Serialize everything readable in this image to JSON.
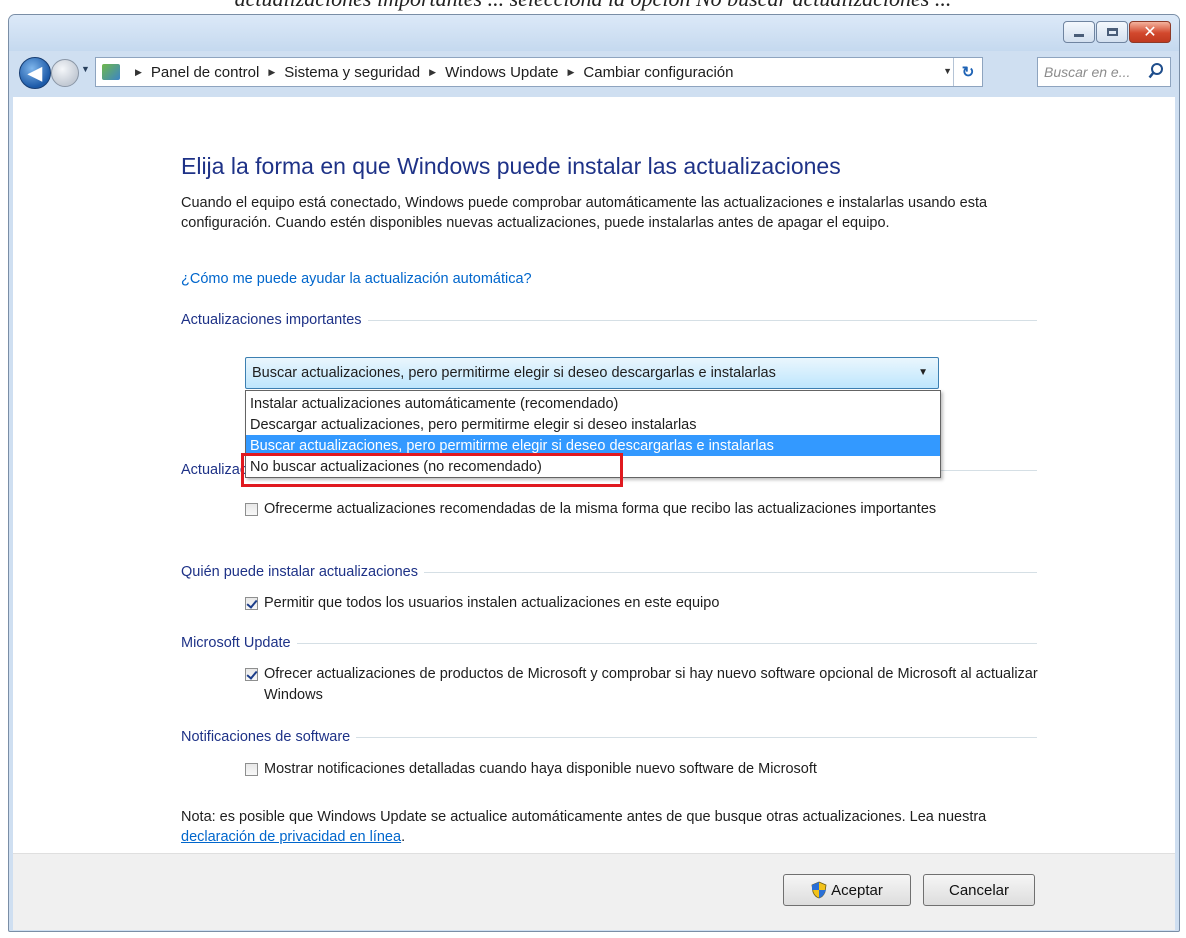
{
  "top_caption": "actualizaciones importantes ... selecciona la opción No buscar actualizaciones ...",
  "window": {
    "caption_buttons": {
      "minimize_icon": "minimize-icon",
      "maximize_icon": "maximize-icon",
      "close_icon": "close-icon"
    }
  },
  "navbar": {
    "breadcrumb": [
      "Panel de control",
      "Sistema y seguridad",
      "Windows Update",
      "Cambiar configuración"
    ],
    "search_placeholder": "Buscar en e..."
  },
  "content": {
    "title": "Elija la forma en que Windows puede instalar las actualizaciones",
    "intro": "Cuando el equipo está conectado, Windows puede comprobar automáticamente las actualizaciones e instalarlas usando esta configuración. Cuando estén disponibles nuevas actualizaciones, puede instalarlas antes de apagar el equipo.",
    "help_link": "¿Cómo me puede ayudar la actualización automática?",
    "important": {
      "heading": "Actualizaciones importantes",
      "selected_value": "Buscar actualizaciones, pero permitirme elegir si deseo descargarlas e instalarlas",
      "options": [
        "Instalar actualizaciones automáticamente (recomendado)",
        "Descargar actualizaciones, pero permitirme elegir si deseo instalarlas",
        "Buscar actualizaciones, pero permitirme elegir si deseo descargarlas e instalarlas",
        "No buscar actualizaciones (no recomendado)"
      ],
      "highlighted_option_index": 2
    },
    "recommended": {
      "heading": "Actualizaciones recomendadas",
      "checkbox_label": "Ofrecerme actualizaciones recomendadas de la misma forma que recibo las actualizaciones importantes",
      "checked": false
    },
    "who": {
      "heading": "Quién puede instalar actualizaciones",
      "checkbox_label": "Permitir que todos los usuarios instalen actualizaciones en este equipo",
      "checked": true
    },
    "microsoft_update": {
      "heading": "Microsoft Update",
      "checkbox_label": "Ofrecer actualizaciones de productos de Microsoft y comprobar si hay nuevo software opcional de Microsoft al actualizar Windows",
      "checked": true
    },
    "notifications": {
      "heading": "Notificaciones de software",
      "checkbox_label": "Mostrar notificaciones detalladas cuando haya disponible nuevo software de Microsoft",
      "checked": false
    },
    "note_text": "Nota: es posible que Windows Update se actualice automáticamente antes de que busque otras actualizaciones. Lea nuestra ",
    "note_link": "declaración de privacidad en línea",
    "note_end": "."
  },
  "footer": {
    "ok_label": "Aceptar",
    "cancel_label": "Cancelar"
  },
  "colors": {
    "heading_blue": "#1e3287",
    "link_blue": "#0066cc",
    "selection_blue": "#3399ff",
    "highlight_red": "#e0191f"
  }
}
